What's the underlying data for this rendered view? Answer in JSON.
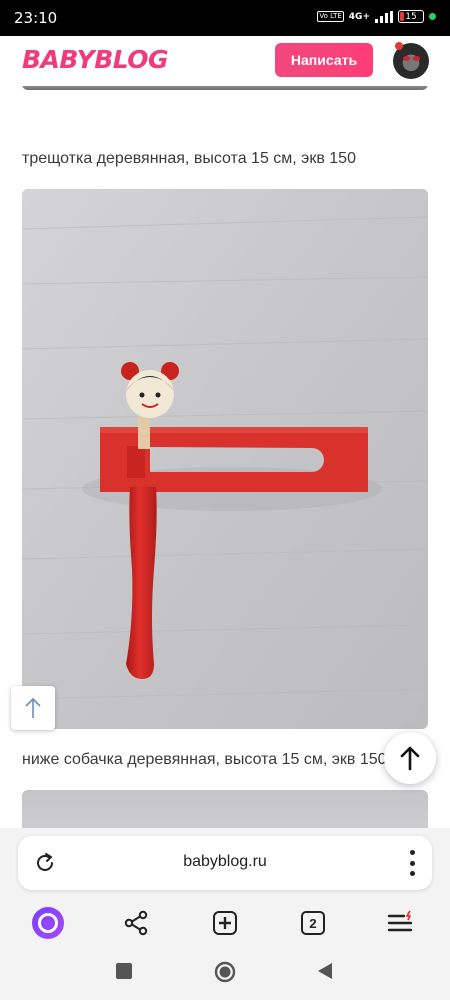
{
  "status_bar": {
    "time": "23:10",
    "volte_label": "Vo LTE",
    "network": "4G+",
    "battery": "15",
    "battery_icon": "battery-low-icon"
  },
  "header": {
    "logo": "BABYBLOG",
    "write_button": "Написать"
  },
  "content": {
    "caption_1": "трещотка деревянная, высота 15 см, экв 150",
    "caption_2": "ниже собачка деревянная, высота 15 см, экв 150"
  },
  "browser": {
    "url": "babyblog.ru",
    "tabs_count": "2"
  },
  "colors": {
    "brand_pink": "#ef3c7a",
    "alice_purple": "#7b3cff"
  }
}
